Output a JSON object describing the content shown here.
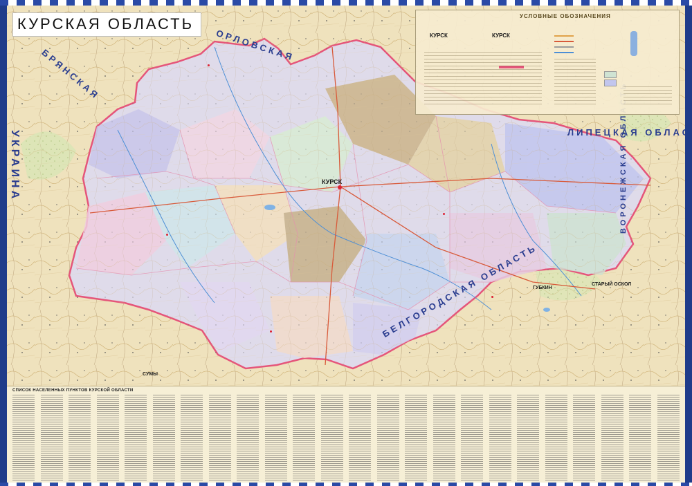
{
  "title": "КУРСКАЯ ОБЛАСТЬ",
  "neighbors": {
    "orel_top": "ОРЛОВСКАЯ",
    "bryansk": "БРЯНСКАЯ",
    "lipetsk": "ЛИПЕЦКАЯ ОБЛАСТЬ",
    "voronezh": "ВОРОНЕЖСКАЯ ОБЛАСТЬ",
    "orel_bottom": "БЕЛГОРОДСКАЯ ОБЛАСТЬ",
    "ukraine_side": "УКРАИНА"
  },
  "cities": {
    "kursk": "КУРСК",
    "stary_oskol": "СТАРЫЙ ОСКОЛ",
    "gubkin": "ГУБКИН",
    "sumy": "СУМЫ"
  },
  "legend": {
    "title": "УСЛОВНЫЕ ОБОЗНАЧЕНИЯ",
    "city_example": "КУРСК"
  },
  "index": {
    "title": "СПИСОК НАСЕЛЕННЫХ ПУНКТОВ КУРСКОЙ ОБЛАСТИ"
  },
  "colors": {
    "oblast_border": "#e5557a",
    "frame": "#2a4aa6",
    "paper": "#f3e7c4"
  }
}
